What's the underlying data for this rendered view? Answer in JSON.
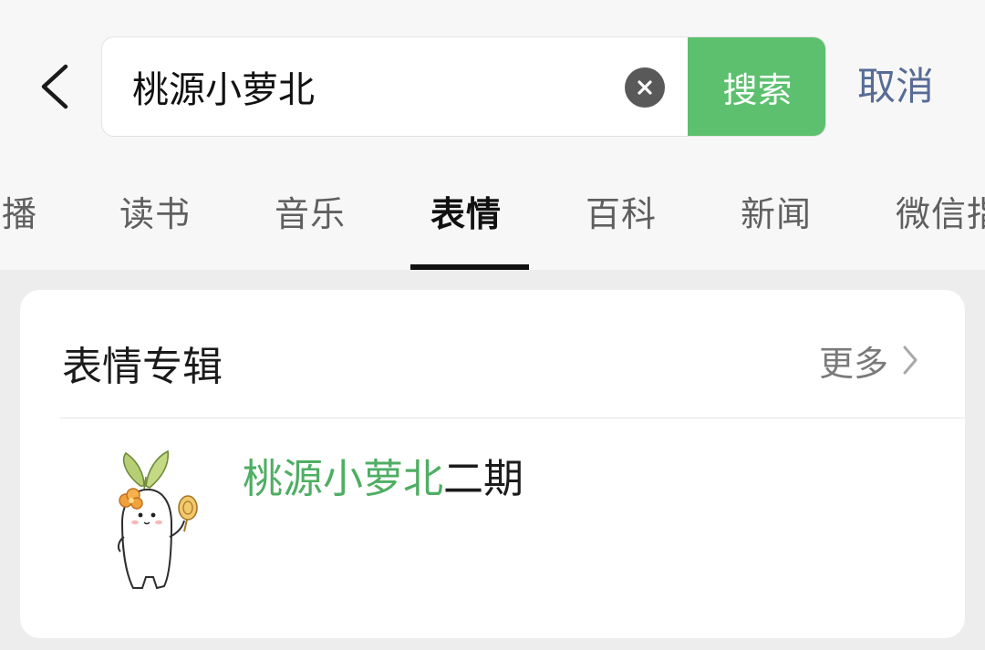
{
  "search": {
    "query": "桃源小萝北",
    "button_label": "搜索",
    "cancel_label": "取消"
  },
  "tabs": [
    {
      "label": "播",
      "active": false
    },
    {
      "label": "读书",
      "active": false
    },
    {
      "label": "音乐",
      "active": false
    },
    {
      "label": "表情",
      "active": true
    },
    {
      "label": "百科",
      "active": false
    },
    {
      "label": "新闻",
      "active": false
    },
    {
      "label": "微信指",
      "active": false
    }
  ],
  "section": {
    "title": "表情专辑",
    "more_label": "更多"
  },
  "results": [
    {
      "title_highlight": "桃源小萝北",
      "title_rest": "二期",
      "icon": "radish-character-sticker"
    }
  ],
  "colors": {
    "accent_green": "#5dc06e",
    "highlight_green": "#4fae63",
    "link_blue": "#576b95"
  }
}
